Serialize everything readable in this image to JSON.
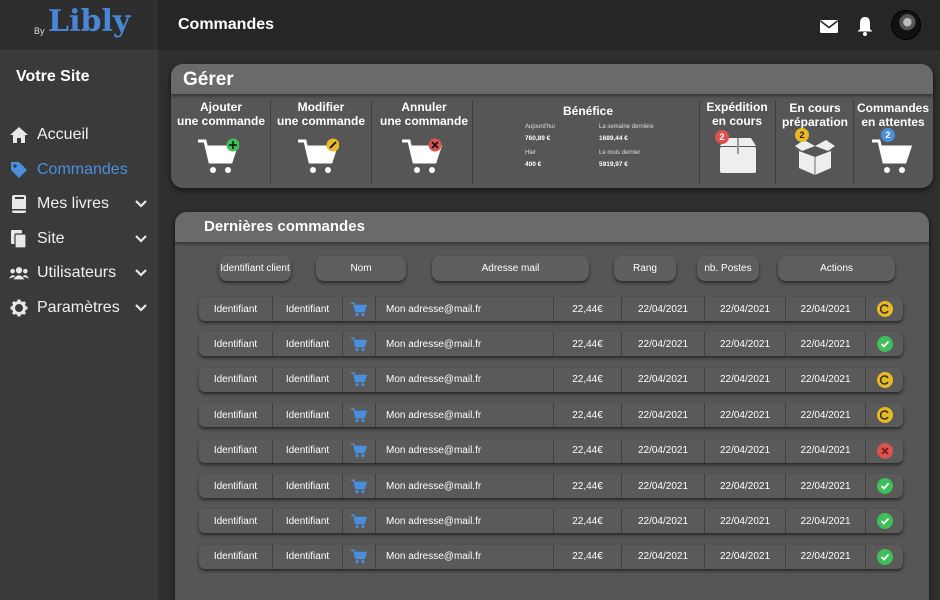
{
  "brand": {
    "by": "By",
    "logo": "Libly"
  },
  "sidebar": {
    "site_title": "Votre Site",
    "items": [
      {
        "label": "Accueil",
        "icon": "home-icon",
        "active": false,
        "expandable": false
      },
      {
        "label": "Commandes",
        "icon": "tag-icon",
        "active": true,
        "expandable": false
      },
      {
        "label": "Mes livres",
        "icon": "book-icon",
        "active": false,
        "expandable": true
      },
      {
        "label": "Site",
        "icon": "pages-icon",
        "active": false,
        "expandable": true
      },
      {
        "label": "Utilisateurs",
        "icon": "users-icon",
        "active": false,
        "expandable": true
      },
      {
        "label": "Paramètres",
        "icon": "gear-icon",
        "active": false,
        "expandable": true
      }
    ]
  },
  "header": {
    "title": "Commandes",
    "icons": [
      "mail-icon",
      "bell-icon",
      "avatar"
    ]
  },
  "manage": {
    "title": "Gérer",
    "actions": [
      {
        "line1": "Ajouter",
        "line2": "une commande",
        "badge": "plus"
      },
      {
        "line1": "Modifier",
        "line2": "une commande",
        "badge": "pencil"
      },
      {
        "line1": "Annuler",
        "line2": "une commande",
        "badge": "cross"
      }
    ],
    "benefice": {
      "title": "Bénéfice",
      "stats": [
        {
          "label": "Aujourd'hui",
          "value": "760,89 €"
        },
        {
          "label": "La semaine dernière",
          "value": "1689,44 €"
        },
        {
          "label": "Hier",
          "value": "400 €"
        },
        {
          "label": "Le mois dernier",
          "value": "5919,97 €"
        }
      ]
    },
    "status_tiles": [
      {
        "line1": "Expédition",
        "line2": "en cours",
        "count": "2",
        "badge_color": "#d9534f"
      },
      {
        "line1": "En cours",
        "line2": "préparation",
        "count": "2",
        "badge_color": "#e8b923"
      },
      {
        "line1": "Commandes",
        "line2": "en attentes",
        "count": "2",
        "badge_color": "#4a8ede"
      }
    ]
  },
  "orders": {
    "title": "Dernières commandes",
    "columns": [
      "Identifiant client",
      "Nom",
      "Adresse mail",
      "Rang",
      "nb. Postes",
      "Actions"
    ],
    "rows": [
      {
        "id": "Identifiant",
        "name": "Identifiant",
        "email": "Mon adresse@mail.fr",
        "amount": "22,44€",
        "d1": "22/04/2021",
        "d2": "22/04/2021",
        "d3": "22/04/2021",
        "status": "pending"
      },
      {
        "id": "Identifiant",
        "name": "Identifiant",
        "email": "Mon adresse@mail.fr",
        "amount": "22,44€",
        "d1": "22/04/2021",
        "d2": "22/04/2021",
        "d3": "22/04/2021",
        "status": "done"
      },
      {
        "id": "Identifiant",
        "name": "Identifiant",
        "email": "Mon adresse@mail.fr",
        "amount": "22,44€",
        "d1": "22/04/2021",
        "d2": "22/04/2021",
        "d3": "22/04/2021",
        "status": "pending"
      },
      {
        "id": "Identifiant",
        "name": "Identifiant",
        "email": "Mon adresse@mail.fr",
        "amount": "22,44€",
        "d1": "22/04/2021",
        "d2": "22/04/2021",
        "d3": "22/04/2021",
        "status": "pending"
      },
      {
        "id": "Identifiant",
        "name": "Identifiant",
        "email": "Mon adresse@mail.fr",
        "amount": "22,44€",
        "d1": "22/04/2021",
        "d2": "22/04/2021",
        "d3": "22/04/2021",
        "status": "cancelled"
      },
      {
        "id": "Identifiant",
        "name": "Identifiant",
        "email": "Mon adresse@mail.fr",
        "amount": "22,44€",
        "d1": "22/04/2021",
        "d2": "22/04/2021",
        "d3": "22/04/2021",
        "status": "done"
      },
      {
        "id": "Identifiant",
        "name": "Identifiant",
        "email": "Mon adresse@mail.fr",
        "amount": "22,44€",
        "d1": "22/04/2021",
        "d2": "22/04/2021",
        "d3": "22/04/2021",
        "status": "done"
      },
      {
        "id": "Identifiant",
        "name": "Identifiant",
        "email": "Mon adresse@mail.fr",
        "amount": "22,44€",
        "d1": "22/04/2021",
        "d2": "22/04/2021",
        "d3": "22/04/2021",
        "status": "done"
      }
    ]
  },
  "colors": {
    "accent": "#4a8ede",
    "pending": "#e8b923",
    "done": "#3fbf5a",
    "cancelled": "#d9534f",
    "cart_icon": "#4a8ede"
  }
}
